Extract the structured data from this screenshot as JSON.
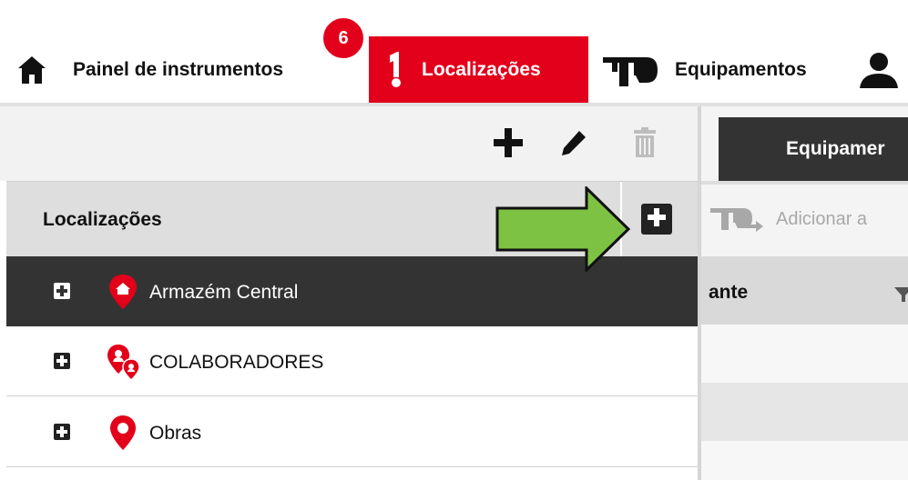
{
  "nav": {
    "items": [
      {
        "label": "Painel de instrumentos",
        "icon": "home-icon"
      },
      {
        "label": "Localizações",
        "icon": "location-tool-icon",
        "active": true
      },
      {
        "label": "Equipamentos",
        "icon": "equipment-icon"
      },
      {
        "label": "",
        "icon": "user-icon"
      }
    ],
    "badge_count": "6"
  },
  "left_panel": {
    "toolbar": {
      "add_icon": "plus-icon",
      "edit_icon": "pencil-icon",
      "delete_icon": "trash-icon"
    },
    "header_title": "Localizações",
    "add_location_icon": "plus-square-icon",
    "rows": [
      {
        "label": "Armazém Central",
        "icon": "warehouse-pin-icon",
        "selected": true
      },
      {
        "label": "COLABORADORES",
        "icon": "people-pin-icon",
        "selected": false
      },
      {
        "label": "Obras",
        "icon": "location-pin-icon",
        "selected": false
      }
    ]
  },
  "right_panel": {
    "tab_label": "Equipamer",
    "add_assign_label": "Adicionar a",
    "column_header": "ante"
  },
  "colors": {
    "accent": "#e2001a",
    "dark": "#333333",
    "annotation_arrow": "#7dc242"
  }
}
